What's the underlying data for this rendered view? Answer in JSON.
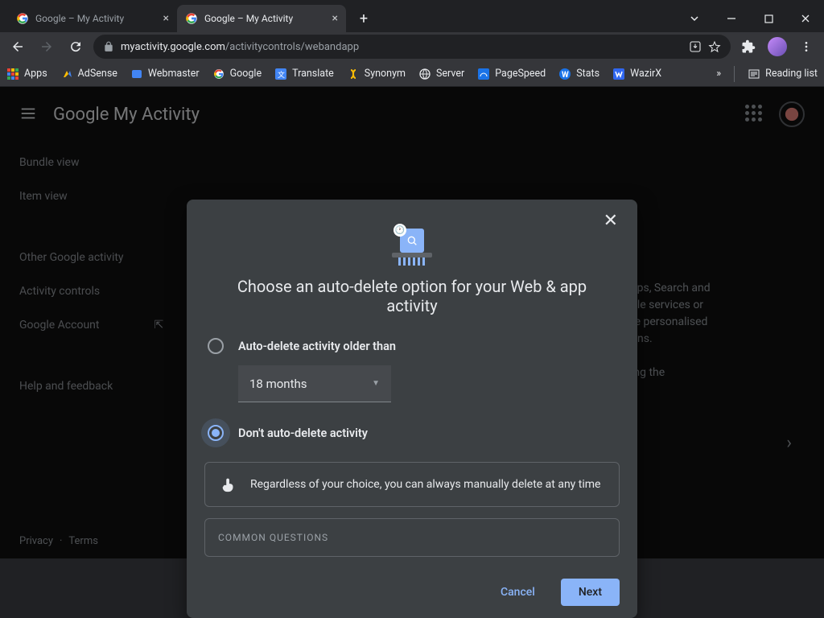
{
  "browser": {
    "tabs": [
      {
        "title": "Google – My Activity",
        "active": false
      },
      {
        "title": "Google – My Activity",
        "active": true
      }
    ],
    "url_host": "myactivity.google.com",
    "url_path": "/activitycontrols/webandapp",
    "bookmarks": [
      "Apps",
      "AdSense",
      "Webmaster",
      "Google",
      "Translate",
      "Synonym",
      "Server",
      "PageSpeed",
      "Stats",
      "WazirX"
    ],
    "overflow": "»",
    "reading_list": "Reading list"
  },
  "page": {
    "title_brand": "Google",
    "title_rest": " My Activity",
    "dimnav": [
      "Bundle view",
      "Item view",
      "",
      "Other Google activity",
      "Activity controls",
      "Google Account",
      "",
      "Help and feedback"
    ],
    "body_lines": [
      "aps, Search and",
      "gle services or",
      "re personalised",
      "ons.",
      "",
      "ing the"
    ],
    "footer": [
      "Privacy",
      "·",
      "Terms"
    ]
  },
  "dialog": {
    "heading": "Choose an auto-delete option for your Web & app activity",
    "option1": "Auto-delete activity older than",
    "select_value": "18 months",
    "option2": "Don't auto-delete activity",
    "note": "Regardless of your choice, you can always manually delete at any time",
    "cq": "COMMON QUESTIONS",
    "cancel": "Cancel",
    "next": "Next"
  }
}
